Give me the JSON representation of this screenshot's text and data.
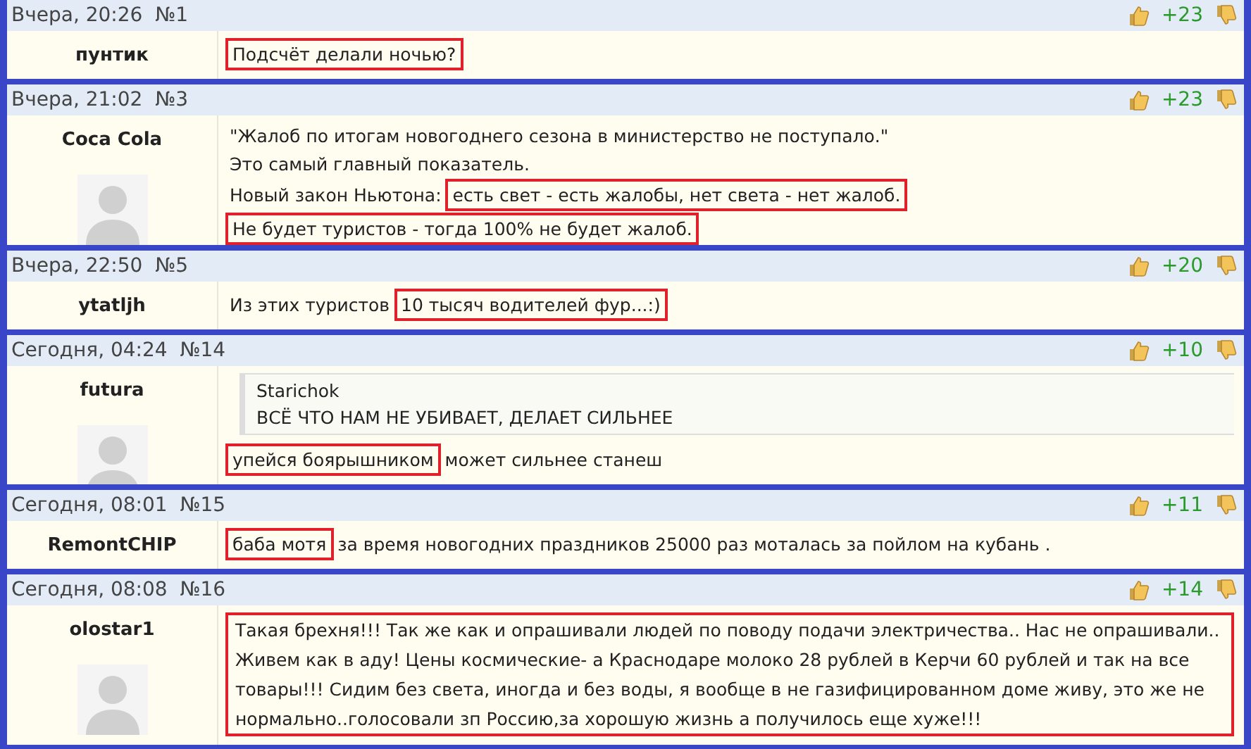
{
  "comments": [
    {
      "date": "Вчера, 20:26",
      "number": "№1",
      "score": "+23",
      "author": "пунтик",
      "avatar": false,
      "body": [
        {
          "kind": "line",
          "segments": [
            {
              "text": "Подсчёт делали ночью?",
              "highlighted": true
            }
          ]
        }
      ]
    },
    {
      "date": "Вчера, 21:02",
      "number": "№3",
      "score": "+23",
      "author": "Coca Cola",
      "avatar": true,
      "body": [
        {
          "kind": "line",
          "segments": [
            {
              "text": "\"Жалоб по итогам новогоднего сезона в министерство не поступало.\"",
              "highlighted": false
            }
          ]
        },
        {
          "kind": "line",
          "segments": [
            {
              "text": "Это самый главный показатель.",
              "highlighted": false
            }
          ]
        },
        {
          "kind": "line",
          "segments": [
            {
              "text": "Новый закон Ньютона:",
              "highlighted": false
            },
            {
              "text": "есть свет - есть жалобы, нет света - нет жалоб.",
              "highlighted": true
            }
          ]
        },
        {
          "kind": "line",
          "segments": [
            {
              "text": "Не будет туристов - тогда 100% не будет жалоб.",
              "highlighted": true
            }
          ]
        }
      ]
    },
    {
      "date": "Вчера, 22:50",
      "number": "№5",
      "score": "+20",
      "author": "ytatljh",
      "avatar": false,
      "body": [
        {
          "kind": "line",
          "segments": [
            {
              "text": "Из этих туристов",
              "highlighted": false
            },
            {
              "text": "10 тысяч водителей фур...:)",
              "highlighted": true
            }
          ]
        }
      ]
    },
    {
      "date": "Сегодня, 04:24",
      "number": "№14",
      "score": "+10",
      "author": "futura",
      "avatar": true,
      "body": [
        {
          "kind": "quote",
          "author": "Starichok",
          "text": "ВСЁ ЧТО НАМ НЕ УБИВАЕТ, ДЕЛАЕТ СИЛЬНЕЕ"
        },
        {
          "kind": "line",
          "segments": [
            {
              "text": "упейся боярышником",
              "highlighted": true
            },
            {
              "text": "может сильнее станеш",
              "highlighted": false
            }
          ]
        }
      ]
    },
    {
      "date": "Сегодня, 08:01",
      "number": "№15",
      "score": "+11",
      "author": "RemontCHIP",
      "avatar": false,
      "body": [
        {
          "kind": "line",
          "segments": [
            {
              "text": "баба мотя",
              "highlighted": true
            },
            {
              "text": "за время новогодних праздников 25000 раз моталась за пойлом на кубань .",
              "highlighted": false
            }
          ]
        }
      ]
    },
    {
      "date": "Сегодня, 08:08",
      "number": "№16",
      "score": "+14",
      "author": "olostar1",
      "avatar": true,
      "body": [
        {
          "kind": "box",
          "text": "Такая брехня!!! Так же как и опрашивали людей по поводу подачи электричества.. Нас не опрашивали.. Живем как в аду! Цены космические- а Краснодаре молоко 28 рублей в Керчи 60 рублей и так на все товары!!! Сидим без света, иногда и без воды, я вообще в не газифицированном доме живу, это же не нормально..голосовали зп Россию,за хорошую жизнь а получилось еще хуже!!!"
        }
      ]
    }
  ]
}
